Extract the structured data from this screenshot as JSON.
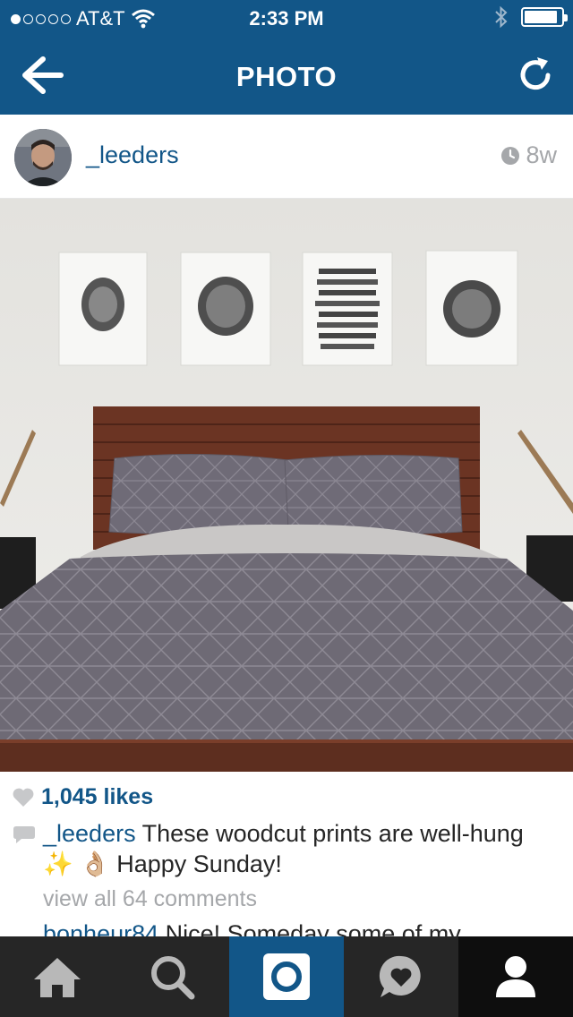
{
  "status_bar": {
    "carrier": "AT&T",
    "time": "2:33 PM",
    "signal_dots_filled": 1,
    "signal_dots_total": 5,
    "battery_level": 0.9
  },
  "nav": {
    "title": "PHOTO",
    "back_icon": "arrow-left-icon",
    "refresh_icon": "refresh-icon"
  },
  "post": {
    "username": "_leeders",
    "age": "8w",
    "likes": "1,045 likes",
    "caption_user": "_leeders",
    "caption_text": " These woodcut prints are well-hung ✨ 👌🏼 Happy Sunday!",
    "view_all": "view all 64 comments",
    "first_comment_user": "bonheur84",
    "first_comment_text": " Nice! Someday some of my"
  },
  "tabs": [
    {
      "name": "home",
      "icon": "home-icon"
    },
    {
      "name": "search",
      "icon": "search-icon"
    },
    {
      "name": "camera",
      "icon": "camera-icon",
      "active": true
    },
    {
      "name": "activity",
      "icon": "heart-bubble-icon"
    },
    {
      "name": "profile",
      "icon": "person-icon"
    }
  ],
  "colors": {
    "brand": "#125688",
    "tabbar": "#262626",
    "muted": "#a5a7aa"
  }
}
